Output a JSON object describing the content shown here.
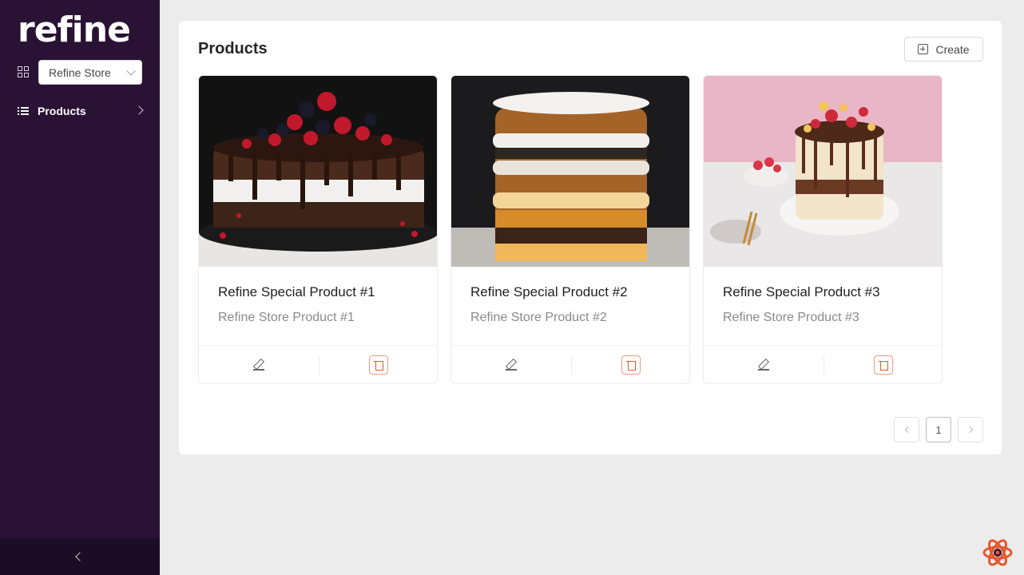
{
  "app": {
    "logo_text": "refine"
  },
  "sidebar": {
    "store_select": {
      "value": "Refine Store"
    },
    "items": [
      {
        "label": "Products",
        "icon": "list-icon"
      }
    ]
  },
  "main": {
    "title": "Products",
    "create_label": "Create",
    "products": [
      {
        "title": "Refine Special Product #1",
        "description": "Refine Store Product #1"
      },
      {
        "title": "Refine Special Product #2",
        "description": "Refine Store Product #2"
      },
      {
        "title": "Refine Special Product #3",
        "description": "Refine Store Product #3"
      }
    ],
    "pagination": {
      "current_page": "1"
    }
  },
  "colors": {
    "sidebar_bg": "#2a1235",
    "delete_accent": "#e3582a"
  }
}
